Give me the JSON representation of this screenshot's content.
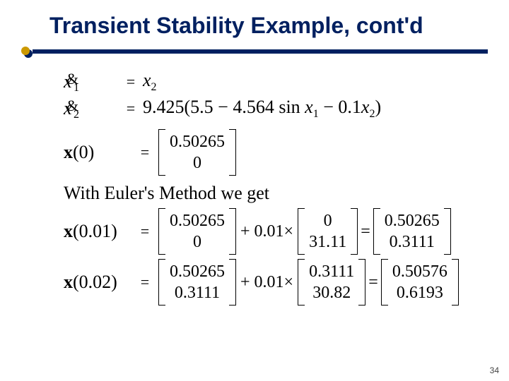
{
  "title": "Transient Stability Example, cont'd",
  "pagenum": "34",
  "eq1": {
    "lhs_var": "x",
    "lhs_sub": "1",
    "amp": "&",
    "eq": "=",
    "rhs_var": "x",
    "rhs_sub": "2"
  },
  "eq2": {
    "lhs_var": "x",
    "lhs_sub": "2",
    "amp": "&",
    "eq": "=",
    "rhs_pre": "9.425",
    "rhs_paren": "(5.5 − 4.564 sin ",
    "rhs_x": "x",
    "rhs_xsub": "1",
    "rhs_mid": " − 0.1",
    "rhs_x2": "x",
    "rhs_x2sub": "2",
    "rhs_close": ")"
  },
  "x0": {
    "label_bold": "x",
    "label_rest": "(0)",
    "eq": "=",
    "vec": [
      "0.50265",
      "0"
    ]
  },
  "note": "With Euler's Method we get",
  "step1": {
    "label_bold": "x",
    "label_rest": "(0.01)",
    "eq": "=",
    "m1": [
      "0.50265",
      "0"
    ],
    "plus": "+ 0.01×",
    "m2": [
      "0",
      "31.11"
    ],
    "eq2": "=",
    "m3": [
      "0.50265",
      "0.3111"
    ]
  },
  "step2": {
    "label_bold": "x",
    "label_rest": "(0.02)",
    "eq": "=",
    "m1": [
      "0.50265",
      "0.3111"
    ],
    "plus": "+ 0.01×",
    "m2": [
      "0.3111",
      "30.82"
    ],
    "eq2": "=",
    "m3": [
      "0.50576",
      "0.6193"
    ]
  }
}
